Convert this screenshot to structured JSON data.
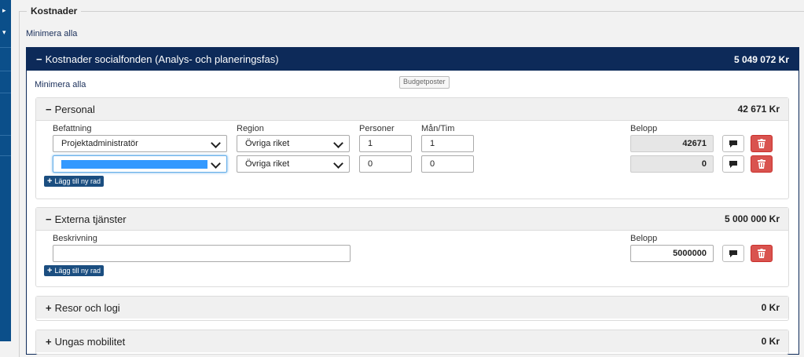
{
  "section": {
    "legend": "Kostnader",
    "minimize_all": "Minimera alla"
  },
  "main_panel": {
    "title": "Kostnader socialfonden (Analys- och planeringsfas)",
    "amount": "5 049 072 Kr",
    "minimize_all": "Minimera alla",
    "budget_button": "Budgetposter"
  },
  "personal": {
    "title": "Personal",
    "amount": "42 671 Kr",
    "columns": {
      "position": "Befattning",
      "region": "Region",
      "persons": "Personer",
      "months": "Mån/Tim",
      "amount": "Belopp"
    },
    "rows": [
      {
        "position": "Projektadministratör",
        "region": "Övriga riket",
        "persons": "1",
        "months": "1",
        "amount": "42671"
      },
      {
        "position": "",
        "region": "Övriga riket",
        "persons": "0",
        "months": "0",
        "amount": "0"
      }
    ],
    "add_row": "Lägg till ny rad"
  },
  "external": {
    "title": "Externa tjänster",
    "amount": "5 000 000 Kr",
    "columns": {
      "description": "Beskrivning",
      "amount": "Belopp"
    },
    "rows": [
      {
        "description": "",
        "amount": "5000000"
      }
    ],
    "add_row": "Lägg till ny rad"
  },
  "travel": {
    "title": "Resor och logi",
    "amount": "0 Kr"
  },
  "youth": {
    "title": "Ungas mobilitet",
    "amount": "0 Kr"
  },
  "icons": {
    "comment": "comment-icon",
    "delete": "trash-icon",
    "expand": "plus-icon",
    "collapse": "minus-icon",
    "dropdown": "chevron-down-icon"
  },
  "colors": {
    "header_dark": "#0d2a59",
    "delete_red": "#d9534f",
    "add_button": "#1b4e80",
    "selection": "#3399ff"
  }
}
